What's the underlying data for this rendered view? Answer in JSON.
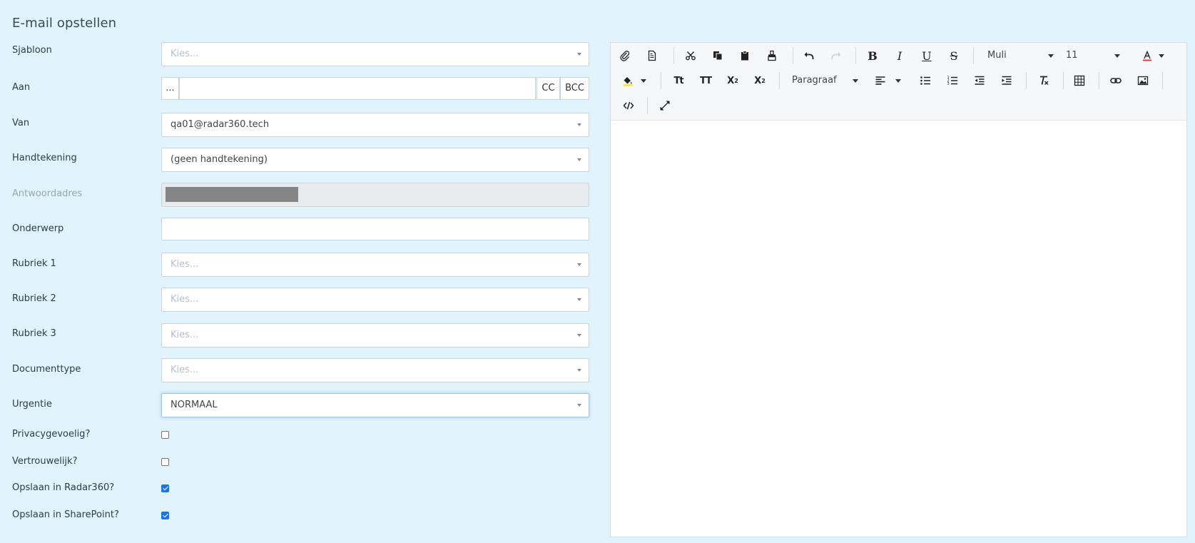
{
  "page": {
    "title": "E-mail opstellen"
  },
  "form": {
    "sjabloon": {
      "label": "Sjabloon",
      "placeholder": "Kies..."
    },
    "aan": {
      "label": "Aan",
      "dots": "...",
      "value": "",
      "cc": "CC",
      "bcc": "BCC"
    },
    "van": {
      "label": "Van",
      "value": "qa01@radar360.tech"
    },
    "handtekening": {
      "label": "Handtekening",
      "value": "(geen handtekening)"
    },
    "antwoordadres": {
      "label": "Antwoordadres"
    },
    "onderwerp": {
      "label": "Onderwerp",
      "value": ""
    },
    "rubriek1": {
      "label": "Rubriek 1",
      "placeholder": "Kies..."
    },
    "rubriek2": {
      "label": "Rubriek 2",
      "placeholder": "Kies..."
    },
    "rubriek3": {
      "label": "Rubriek 3",
      "placeholder": "Kies..."
    },
    "documenttype": {
      "label": "Documenttype",
      "placeholder": "Kies..."
    },
    "urgentie": {
      "label": "Urgentie",
      "value": "NORMAAL"
    },
    "privacygevoelig": {
      "label": "Privacygevoelig?",
      "checked": false
    },
    "vertrouwelijk": {
      "label": "Vertrouwelijk?",
      "checked": false
    },
    "opslaan_radar": {
      "label": "Opslaan in Radar360?",
      "checked": true
    },
    "opslaan_sharepoint": {
      "label": "Opslaan in SharePoint?",
      "checked": true
    }
  },
  "editor": {
    "font_name": "Muli",
    "font_size": "11",
    "paragraph": "Paragraaf",
    "font_color": "#e53935",
    "highlight_color": "#f5e400",
    "body": ""
  }
}
